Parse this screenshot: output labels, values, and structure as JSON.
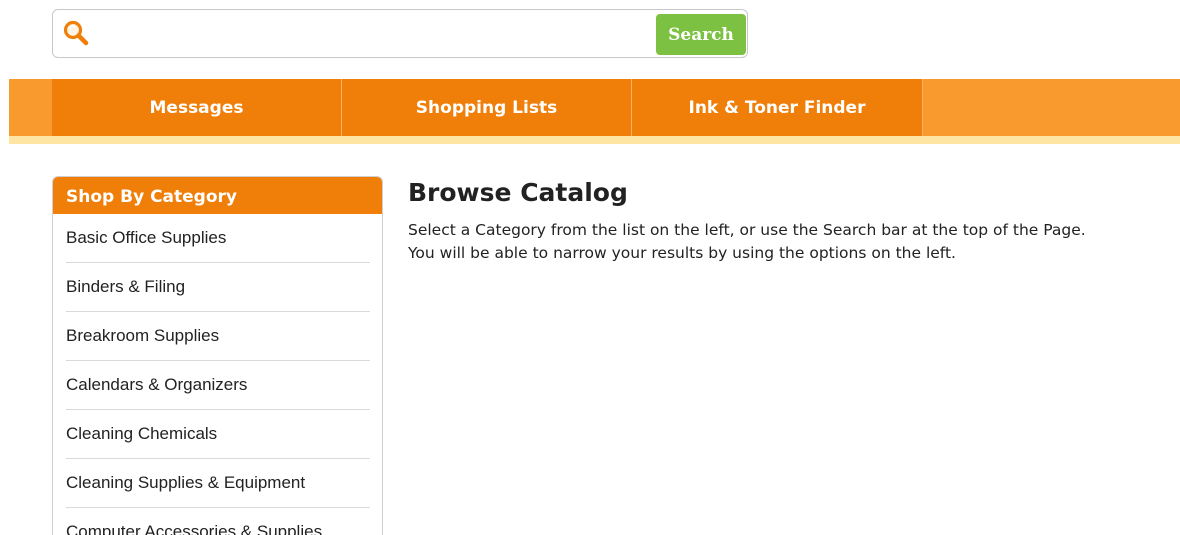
{
  "search": {
    "value": "",
    "placeholder": "",
    "button_label": "Search"
  },
  "nav": {
    "tabs": [
      {
        "label": "Messages"
      },
      {
        "label": "Shopping Lists"
      },
      {
        "label": "Ink & Toner Finder"
      }
    ]
  },
  "sidebar": {
    "title": "Shop By Category",
    "items": [
      {
        "label": "Basic Office Supplies"
      },
      {
        "label": "Binders & Filing"
      },
      {
        "label": "Breakroom Supplies"
      },
      {
        "label": "Calendars & Organizers"
      },
      {
        "label": "Cleaning Chemicals"
      },
      {
        "label": "Cleaning Supplies & Equipment"
      },
      {
        "label": "Computer Accessories & Supplies"
      }
    ]
  },
  "main": {
    "title": "Browse Catalog",
    "description_line1": "Select a Category from the list on the left, or use the Search bar at the top of the Page.",
    "description_line2": "You will be able to narrow your results by using the options on the left."
  },
  "colors": {
    "accent_orange": "#f07f09",
    "nav_background": "#f99a2e",
    "search_button_green": "#7cc142",
    "nav_highlight": "#ffe5a3"
  },
  "icons": {
    "search": "search-icon"
  }
}
